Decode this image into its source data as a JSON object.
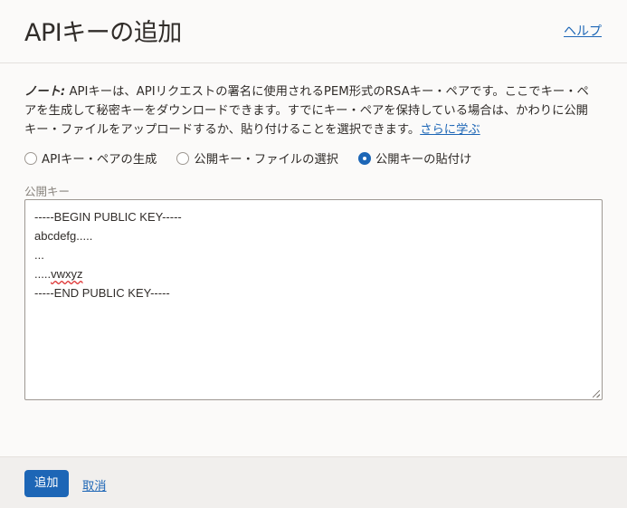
{
  "header": {
    "title": "APIキーの追加",
    "help_label": "ヘルプ"
  },
  "note": {
    "prefix": "ノート:",
    "text": " APIキーは、APIリクエストの署名に使用されるPEM形式のRSAキー・ペアです。ここでキー・ペアを生成して秘密キーをダウンロードできます。すでにキー・ペアを保持している場合は、かわりに公開キー・ファイルをアップロードするか、貼り付けることを選択できます。",
    "learn_more": "さらに学ぶ"
  },
  "options": {
    "items": [
      {
        "label": "APIキー・ペアの生成",
        "checked": false
      },
      {
        "label": "公開キー・ファイルの選択",
        "checked": false
      },
      {
        "label": "公開キーの貼付け",
        "checked": true
      }
    ]
  },
  "public_key": {
    "label": "公開キー",
    "lines": [
      "-----BEGIN PUBLIC KEY-----",
      "abcdefg.....",
      "...",
      ".....",
      "vwxyz",
      "-----END PUBLIC KEY-----"
    ]
  },
  "footer": {
    "add_label": "追加",
    "cancel_label": "取消"
  },
  "colors": {
    "accent": "#1d66b6",
    "background": "#fbfaf9",
    "footer_background": "#f1efed"
  }
}
